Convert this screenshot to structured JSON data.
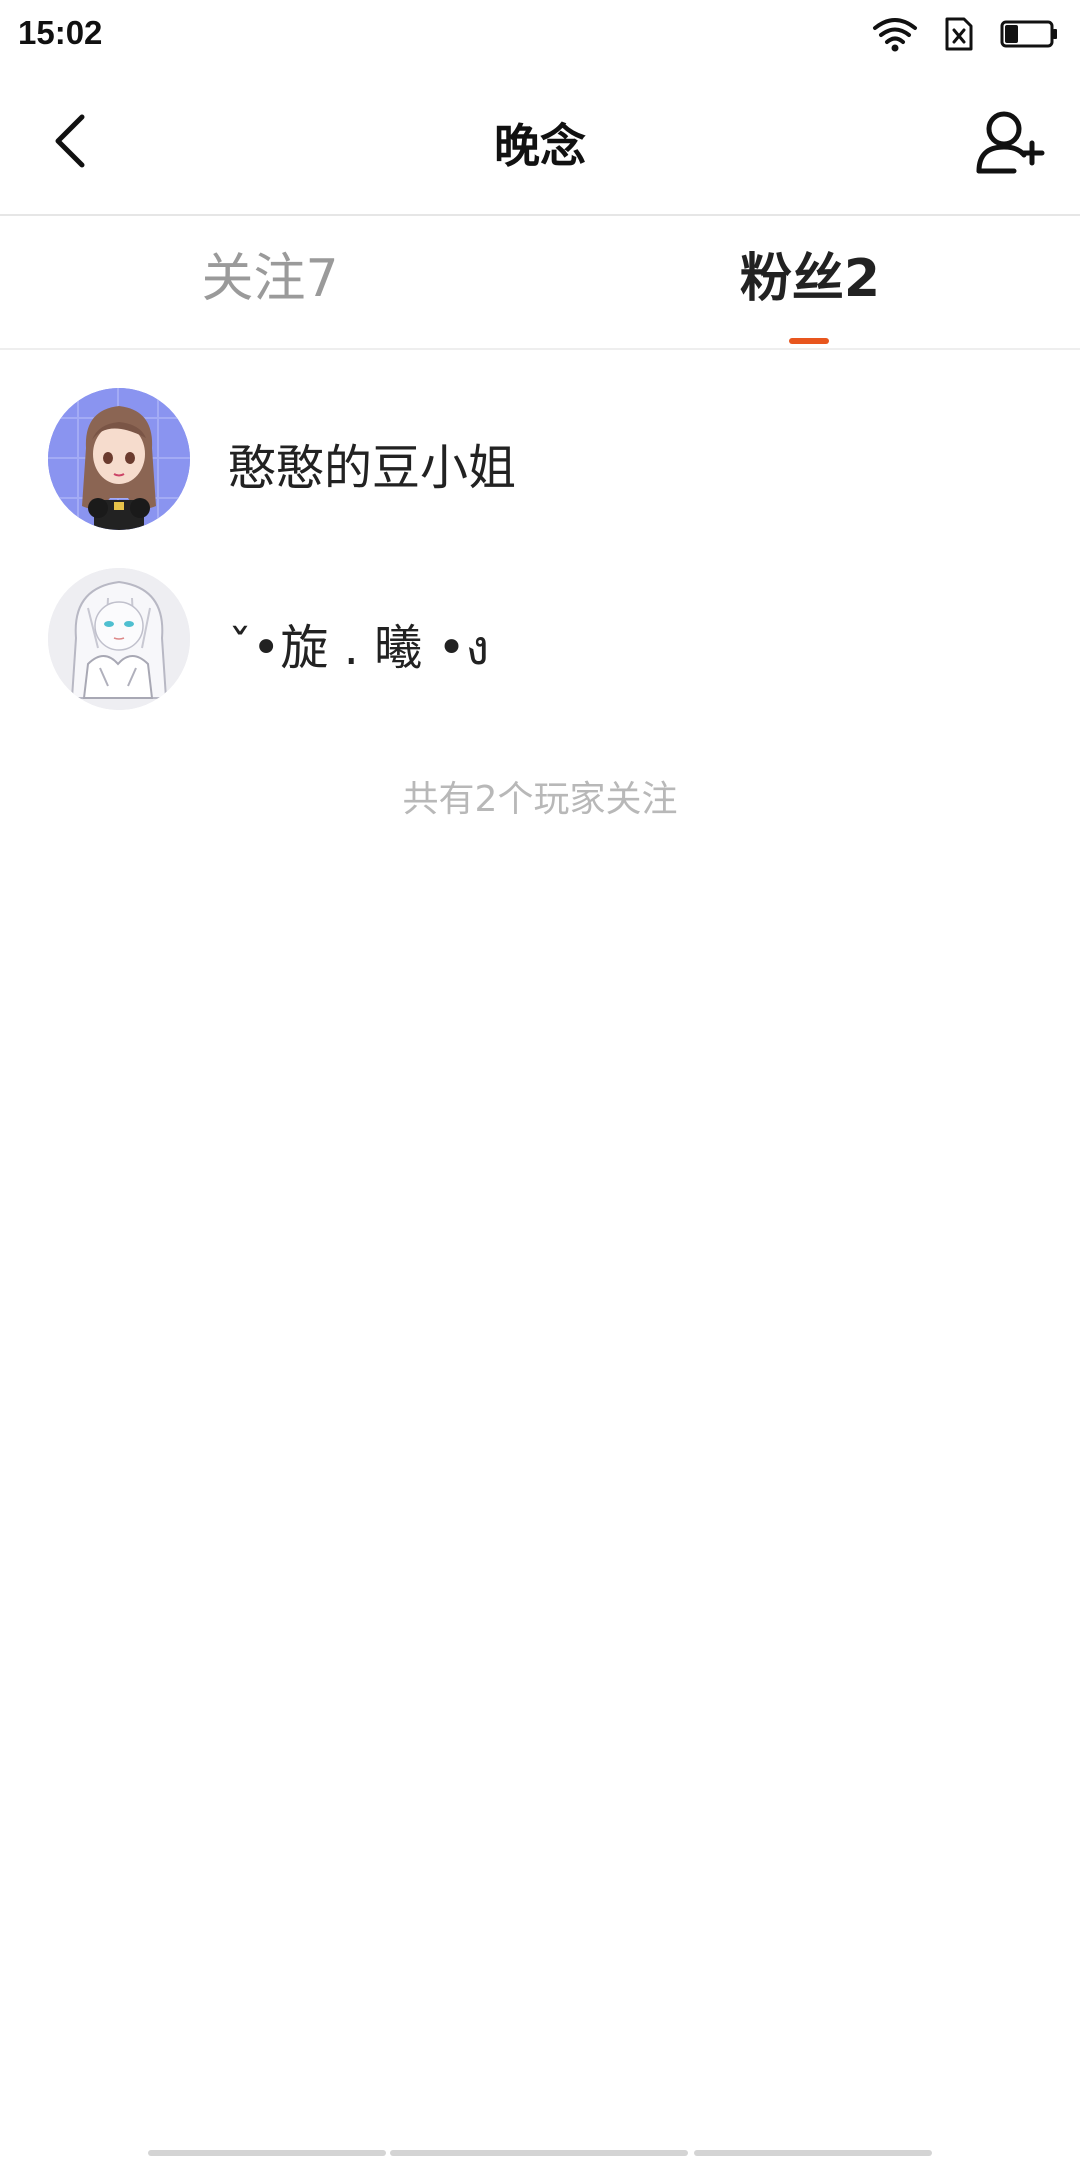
{
  "status_bar": {
    "time": "15:02",
    "icons": [
      "wifi-icon",
      "sim-missing-icon",
      "battery-icon"
    ]
  },
  "header": {
    "title": "晚念",
    "back_icon": "chevron-left-icon",
    "add_user_icon": "user-add-icon"
  },
  "tabs": [
    {
      "label": "关注7",
      "active": false
    },
    {
      "label": "粉丝2",
      "active": true
    }
  ],
  "colors": {
    "accent": "#e8561e",
    "inactive_tab": "#9a9a9a",
    "footer_text": "#b8b8b8"
  },
  "fans": [
    {
      "name": "憨憨的豆小姐",
      "avatar": "avatar-anime-girl-brown-hair"
    },
    {
      "name": "ˇ•旋 . 曦 •ง",
      "avatar": "avatar-sketch-white-hair"
    }
  ],
  "footer_note": "共有2个玩家关注"
}
